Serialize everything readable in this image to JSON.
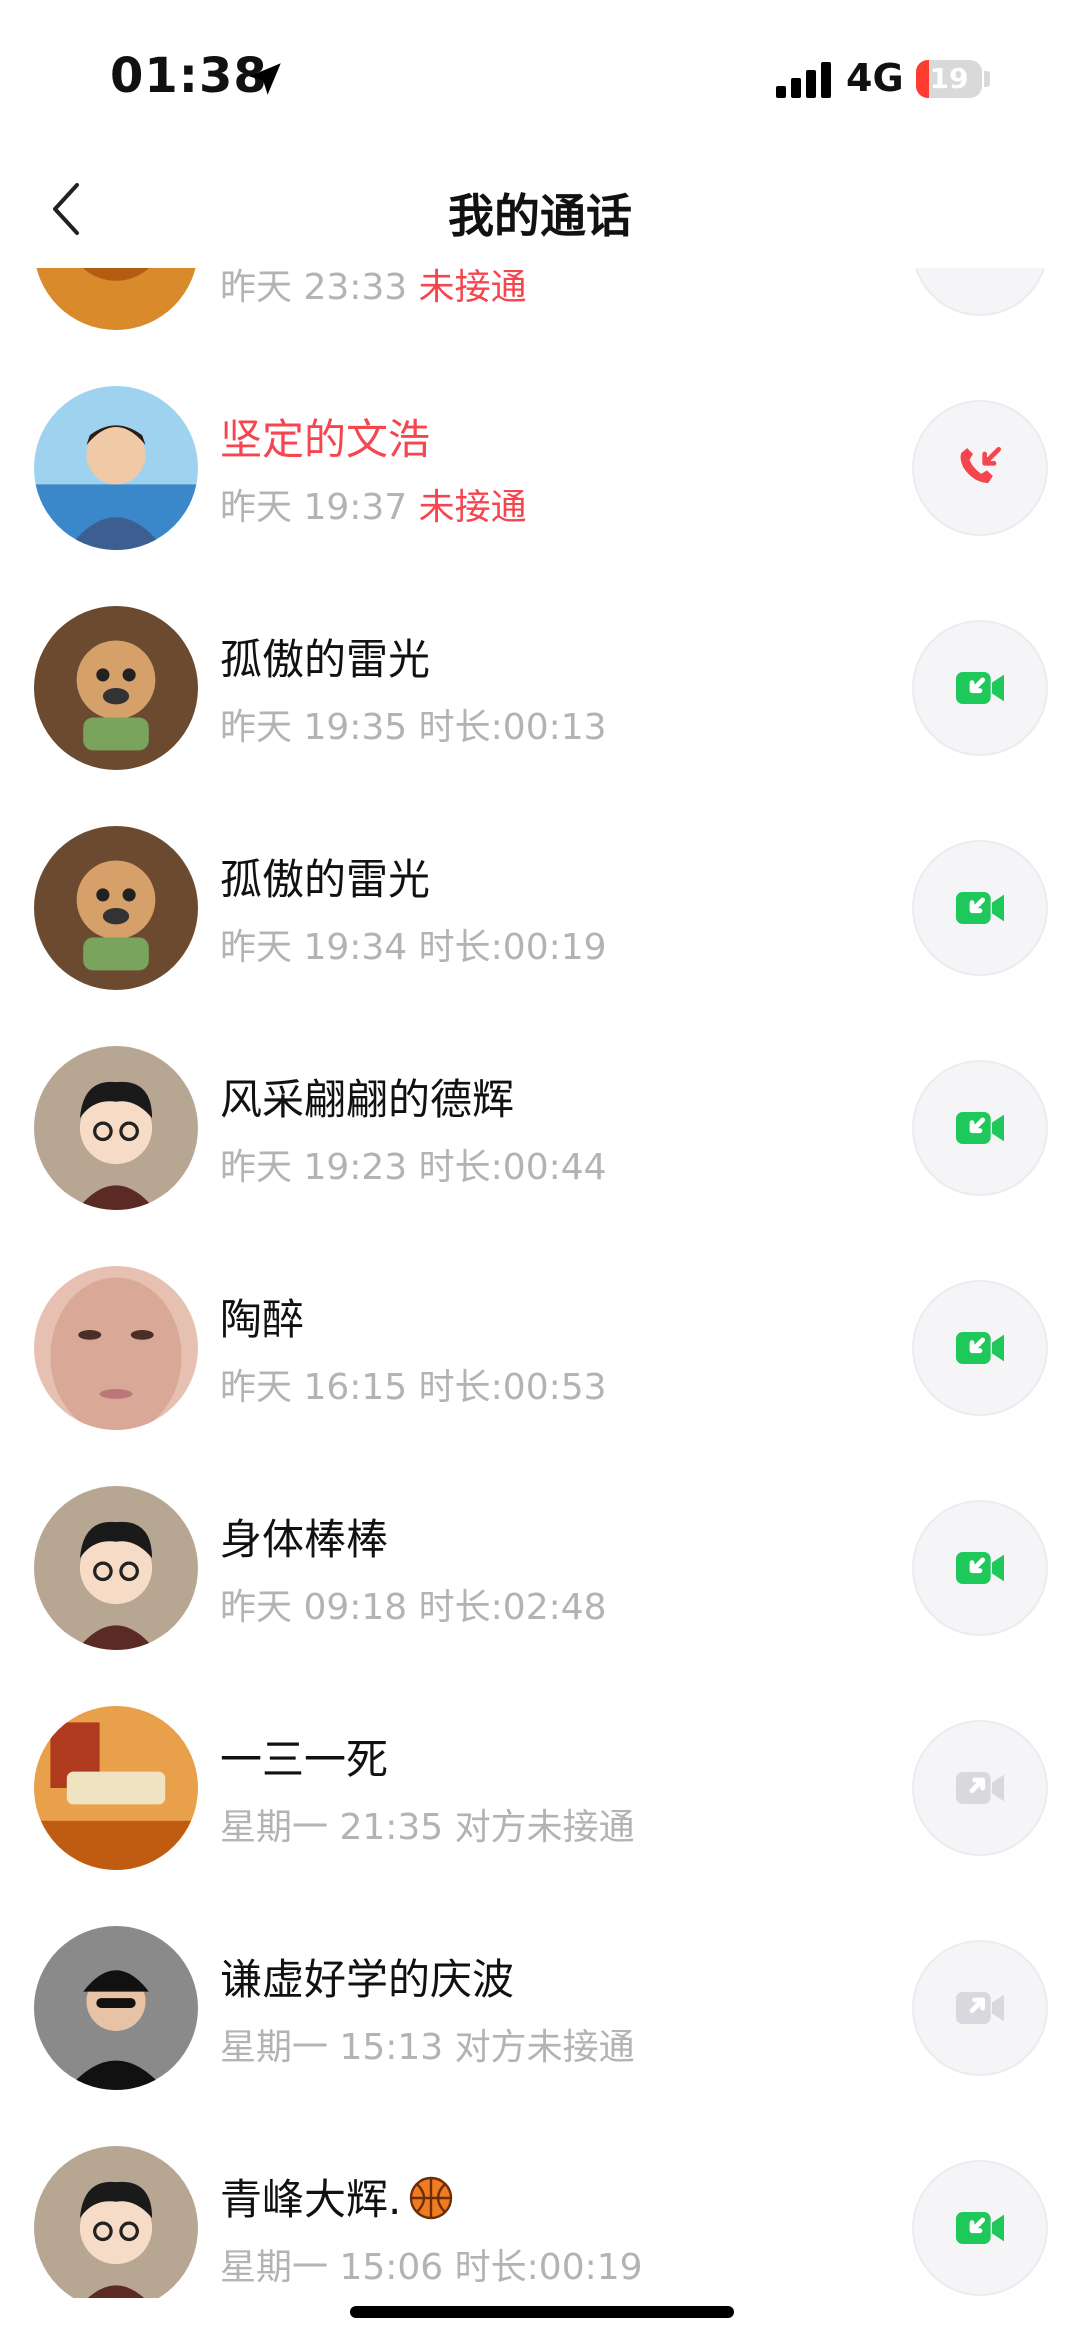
{
  "status_bar": {
    "time": "01:38",
    "network": "4G",
    "battery": "19",
    "battery_level": 0.19,
    "icons": [
      "location-arrow-icon",
      "signal-bars-icon",
      "battery-charging-icon"
    ]
  },
  "header": {
    "title": "我的通话",
    "back_icon": "chevron-left-icon"
  },
  "colors": {
    "missed": "#f5454f",
    "video_green": "#1ec85a",
    "video_disabled": "#d8d8de",
    "meta_gray": "#b3b3b3",
    "button_bg": "#f5f5f7"
  },
  "calls": [
    {
      "name": "",
      "day": "昨天",
      "time": "23:33",
      "status": "未接通",
      "name_missed": true,
      "status_missed": true,
      "call_type": "unknown",
      "call_icon": "call-button"
    },
    {
      "name": "坚定的文浩",
      "day": "昨天",
      "time": "19:37",
      "status": "未接通",
      "name_missed": true,
      "status_missed": true,
      "call_type": "missed-voice",
      "call_icon": "missed-call-icon"
    },
    {
      "name": "孤傲的雷光",
      "day": "昨天",
      "time": "19:35",
      "status": "时长:00:13",
      "call_type": "incoming-video",
      "call_icon": "video-call-icon"
    },
    {
      "name": "孤傲的雷光",
      "day": "昨天",
      "time": "19:34",
      "status": "时长:00:19",
      "call_type": "incoming-video",
      "call_icon": "video-call-icon"
    },
    {
      "name": "风采翩翩的德辉",
      "day": "昨天",
      "time": "19:23",
      "status": "时长:00:44",
      "call_type": "incoming-video",
      "call_icon": "video-call-icon"
    },
    {
      "name": "陶醉",
      "day": "昨天",
      "time": "16:15",
      "status": "时长:00:53",
      "call_type": "incoming-video",
      "call_icon": "video-call-icon"
    },
    {
      "name": "身体棒棒",
      "day": "昨天",
      "time": "09:18",
      "status": "时长:02:48",
      "call_type": "incoming-video",
      "call_icon": "video-call-icon"
    },
    {
      "name": "一三一死",
      "day": "星期一",
      "time": "21:35",
      "status": "对方未接通",
      "call_type": "outgoing-video-unanswered",
      "call_icon": "video-call-icon"
    },
    {
      "name": "谦虚好学的庆波",
      "day": "星期一",
      "time": "15:13",
      "status": "对方未接通",
      "call_type": "outgoing-video-unanswered",
      "call_icon": "video-call-icon"
    },
    {
      "name": "青峰大辉.",
      "name_emoji": "basketball-icon",
      "day": "星期一",
      "time": "15:06",
      "status": "时长:00:19",
      "call_type": "incoming-video",
      "call_icon": "video-call-icon"
    }
  ]
}
